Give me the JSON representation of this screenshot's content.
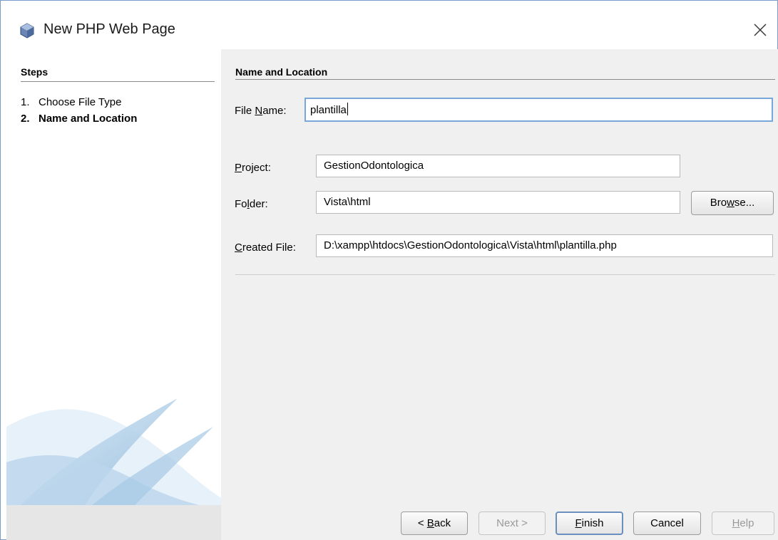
{
  "window": {
    "title": "New PHP Web Page",
    "app_icon": "netbeans-cube-icon",
    "close_icon": "close-icon",
    "close_glyph": "×"
  },
  "steps": {
    "title": "Steps",
    "items": [
      {
        "number": "1.",
        "label": "Choose File Type",
        "current": false
      },
      {
        "number": "2.",
        "label": "Name and Location",
        "current": true
      }
    ]
  },
  "form": {
    "section_title": "Name and Location",
    "file_name": {
      "label_pre": "File ",
      "label_mnemonic": "N",
      "label_post": "ame:",
      "value": "plantilla"
    },
    "project": {
      "label_mnemonic": "P",
      "label_post": "roject:",
      "value": "GestionOdontologica"
    },
    "folder": {
      "label_pre": "Fo",
      "label_mnemonic": "l",
      "label_post": "der:",
      "value": "Vista\\html"
    },
    "browse": {
      "label_pre": "Bro",
      "label_mnemonic": "w",
      "label_post": "se..."
    },
    "created_file": {
      "label_mnemonic": "C",
      "label_post": "reated File:",
      "value": "D:\\xampp\\htdocs\\GestionOdontologica\\Vista\\html\\plantilla.php"
    }
  },
  "buttons": {
    "back": {
      "pre": "< ",
      "mnemonic": "B",
      "post": "ack",
      "enabled": true
    },
    "next": {
      "label": "Next >",
      "enabled": false
    },
    "finish": {
      "mnemonic": "F",
      "post": "inish",
      "enabled": true
    },
    "cancel": {
      "label": "Cancel",
      "enabled": true
    },
    "help": {
      "mnemonic": "H",
      "post": "elp",
      "enabled": false
    }
  },
  "colors": {
    "accent": "#6b8fbf",
    "panel_bg": "#f0f0f0",
    "cube_icon": "#6a86b5"
  }
}
